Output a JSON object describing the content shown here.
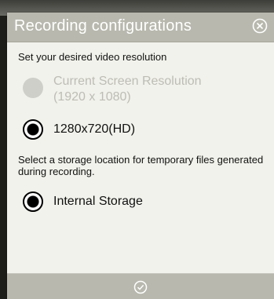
{
  "dialog": {
    "title": "Recording configurations",
    "close_icon": "close-circle-icon",
    "confirm_icon": "check-circle-icon"
  },
  "resolution": {
    "label": "Set your desired video resolution",
    "options": [
      {
        "label": "Current Screen Resolution\n(1920 x 1080)",
        "selected": false,
        "enabled": false
      },
      {
        "label": "1280x720(HD)",
        "selected": true,
        "enabled": true
      }
    ]
  },
  "storage": {
    "label": "Select a storage location for temporary files generated during recording.",
    "options": [
      {
        "label": "Internal Storage",
        "selected": true,
        "enabled": true
      }
    ]
  },
  "colors": {
    "titlebar": "#b8b8ae",
    "panel": "#f2f2ec",
    "disabled_text": "#bdbdb6"
  }
}
